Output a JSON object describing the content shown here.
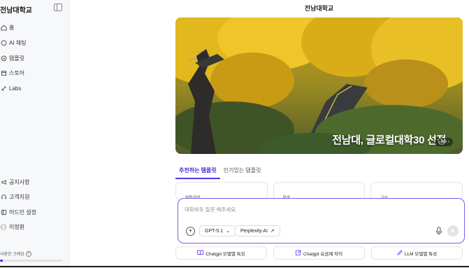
{
  "app": {
    "brand": "전남대학교",
    "page_title": "전남대학교"
  },
  "sidebar": {
    "top_items": [
      {
        "label": "홈",
        "icon": "home-icon"
      },
      {
        "label": "AI 채팅",
        "icon": "chat-icon"
      },
      {
        "label": "템플릿",
        "icon": "template-icon"
      },
      {
        "label": "스토어",
        "icon": "store-icon"
      },
      {
        "label": "Labs",
        "icon": "labs-icon"
      }
    ],
    "bottom_items": [
      {
        "label": "공지사항",
        "icon": "megaphone-icon"
      },
      {
        "label": "고객지원",
        "icon": "headset-icon"
      },
      {
        "label": "어드민 설정",
        "icon": "admin-icon"
      },
      {
        "label": "이정환",
        "icon": "avatar"
      }
    ],
    "credit_label": "사용한 크레딧",
    "credit_help": "?",
    "credit_used_fraction": 0.05,
    "accent": "#5a2ee0"
  },
  "banner": {
    "title": "전남대, 글로컬대학30 선정",
    "pager_text": "3/6",
    "pager_prev": "‹",
    "pager_next": "›"
  },
  "tabs": [
    {
      "label": "추천하는 템플릿",
      "active": true
    },
    {
      "label": "인기있는 템플릿",
      "active": false
    }
  ],
  "template_cards": [
    {
      "label": "범용/일반"
    },
    {
      "label": "학생"
    },
    {
      "label": "교사"
    }
  ],
  "composer": {
    "placeholder": "대화하듯 질문 해주세요.",
    "model_label": "GPT-5.1",
    "model_caret": "⌄",
    "perplexity_label": "Perplexity AI",
    "perplexity_arrow": "↗"
  },
  "suggestions": [
    {
      "label": "Chatgpt 모델별 특징",
      "icon": "book-icon"
    },
    {
      "label": "Chatgpt 요금제 차이",
      "icon": "edit-icon"
    },
    {
      "label": "LLM 모델별 특성",
      "icon": "pen-icon"
    }
  ]
}
